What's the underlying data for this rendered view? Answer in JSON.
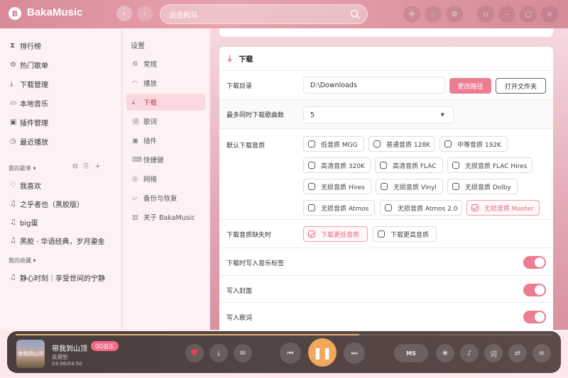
{
  "app": {
    "name": "BakaMusic",
    "logo": "B"
  },
  "search": {
    "query": "说谎的马"
  },
  "sidebar": {
    "items": [
      {
        "label": "排行榜",
        "icon": "hourglass-icon"
      },
      {
        "label": "热门歌单",
        "icon": "gear-icon"
      },
      {
        "label": "下载管理",
        "icon": "download-icon"
      },
      {
        "label": "本地音乐",
        "icon": "folder-icon"
      },
      {
        "label": "插件管理",
        "icon": "plugin-icon"
      },
      {
        "label": "最近播放",
        "icon": "clock-icon"
      }
    ],
    "my_playlists_header": "我的歌单",
    "my_playlists": [
      "我喜欢",
      "之乎者也（黑胶版）",
      "big蛋",
      "黑胶 · 华语经典，岁月鎏金"
    ],
    "collections_header": "我的收藏",
    "collections": [
      "静心时刻｜享受世间的宁静"
    ]
  },
  "settings_nav": {
    "title": "设置",
    "items": [
      {
        "label": "常规",
        "icon": "gear-icon"
      },
      {
        "label": "播放",
        "icon": "headphones-icon"
      },
      {
        "label": "下载",
        "icon": "download-icon",
        "active": true
      },
      {
        "label": "歌词",
        "icon": "lyrics-icon"
      },
      {
        "label": "插件",
        "icon": "plugin-icon"
      },
      {
        "label": "快捷键",
        "icon": "keyboard-icon"
      },
      {
        "label": "网络",
        "icon": "network-icon"
      },
      {
        "label": "备份与恢复",
        "icon": "backup-icon"
      },
      {
        "label": "关于 BakaMusic",
        "icon": "info-icon"
      }
    ]
  },
  "download": {
    "title": "下载",
    "dir_label": "下载目录",
    "dir_value": "D:\\Downloads",
    "change_path": "更改路径",
    "open_folder": "打开文件夹",
    "max_label": "最多同时下载歌曲数",
    "max_value": "5",
    "quality_label": "默认下载音质",
    "qualities": [
      {
        "label": "低音质 MGG",
        "checked": false
      },
      {
        "label": "普通音质 128K",
        "checked": false
      },
      {
        "label": "中等音质 192K",
        "checked": false
      },
      {
        "label": "高清音质 320K",
        "checked": false
      },
      {
        "label": "高清音质 FLAC",
        "checked": false
      },
      {
        "label": "无损音质 FLAC Hires",
        "checked": false
      },
      {
        "label": "无损音质 Hires",
        "checked": false
      },
      {
        "label": "无损音质 Vinyl",
        "checked": false
      },
      {
        "label": "无损音质 Dolby",
        "checked": false
      },
      {
        "label": "无损音质 Atmos",
        "checked": false
      },
      {
        "label": "无损音质 Atmos 2.0",
        "checked": false
      },
      {
        "label": "无损音质 Master",
        "checked": true
      }
    ],
    "missing_label": "下载音质缺失时",
    "missing_options": [
      {
        "label": "下载更低音质",
        "checked": true
      },
      {
        "label": "下载更高音质",
        "checked": false
      }
    ],
    "toggles": [
      {
        "label": "下载时写入音乐标签",
        "on": true
      },
      {
        "label": "写入封面",
        "on": true
      },
      {
        "label": "写入歌词",
        "on": true
      }
    ]
  },
  "player": {
    "cover_text": "带我到山顶",
    "title": "带我到山顶",
    "source": "QQ音乐",
    "artist": "吴黛愁",
    "time": "03:06/04:50",
    "progress": 0.64,
    "mode_label": "MS",
    "lyrics_label": "词",
    "accent": "#f2a85c"
  }
}
